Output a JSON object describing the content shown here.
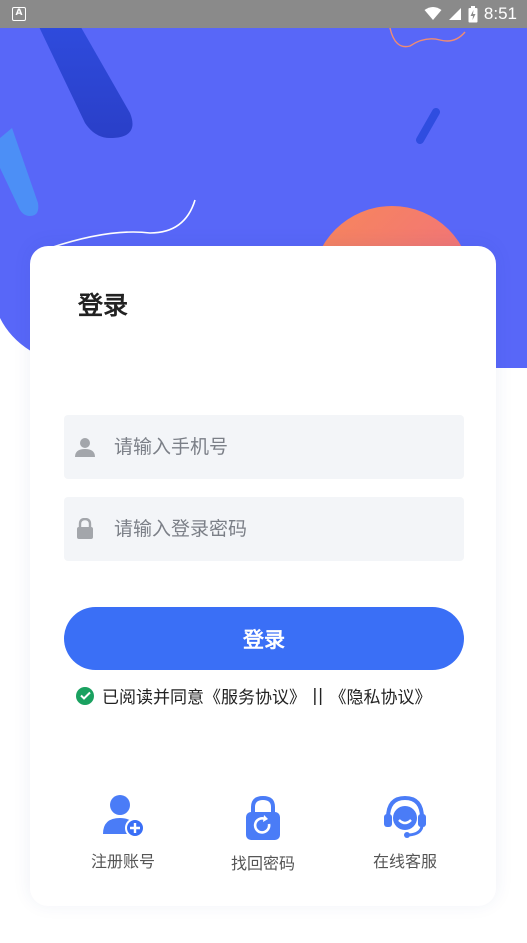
{
  "status_bar": {
    "app_badge": "A",
    "time": "8:51"
  },
  "login": {
    "title": "登录",
    "phone_placeholder": "请输入手机号",
    "password_placeholder": "请输入登录密码",
    "submit_label": "登录"
  },
  "agreement": {
    "text": "已阅读并同意",
    "service_link": "《服务协议》",
    "separator": "||",
    "privacy_link": "《隐私协议》",
    "checked": true
  },
  "quick_actions": [
    {
      "icon": "add-user-icon",
      "label": "注册账号"
    },
    {
      "icon": "padlock-refresh-icon",
      "label": "找回密码"
    },
    {
      "icon": "headset-icon",
      "label": "在线客服"
    }
  ],
  "colors": {
    "hero_blue": "#5867f8",
    "primary_button": "#3a6ff6",
    "check_green": "#1aa160",
    "field_bg": "#f3f5f8"
  }
}
